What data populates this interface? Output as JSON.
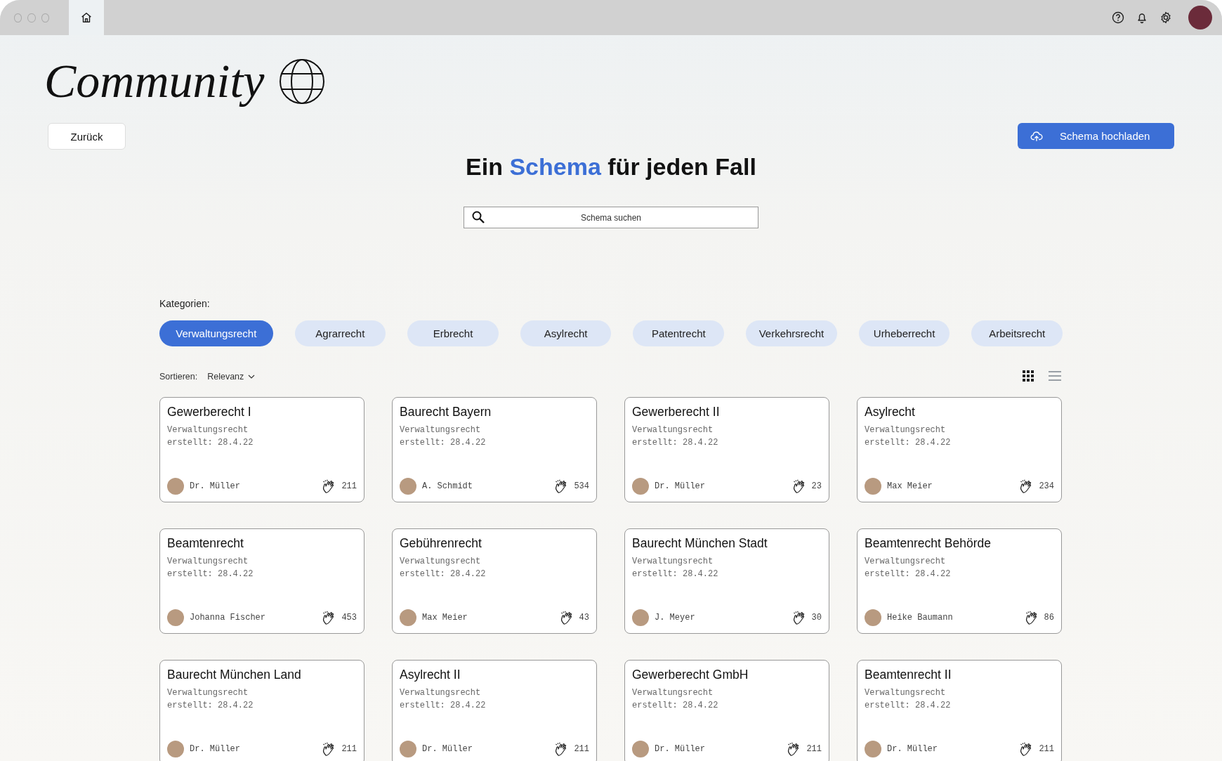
{
  "window": {
    "tabs": [
      {
        "kind": "home",
        "selected": true
      }
    ]
  },
  "page_title": "Community",
  "back_button": "Zurück",
  "upload_button": "Schema hochladen",
  "heading": [
    {
      "text": "Ein ",
      "accent": false
    },
    {
      "text": "Schema",
      "accent": true
    },
    {
      "text": " für jeden Fall",
      "accent": false
    }
  ],
  "search": {
    "placeholder": "Schema suchen"
  },
  "categories_label": "Kategorien:",
  "categories": [
    {
      "label": "Verwaltungsrecht",
      "selected": true
    },
    {
      "label": "Agrarrecht",
      "selected": false
    },
    {
      "label": "Erbrecht",
      "selected": false
    },
    {
      "label": "Asylrecht",
      "selected": false
    },
    {
      "label": "Patentrecht",
      "selected": false
    },
    {
      "label": "Verkehrsrecht",
      "selected": false
    },
    {
      "label": "Urheberrecht",
      "selected": false
    },
    {
      "label": "Arbeitsrecht",
      "selected": false
    }
  ],
  "sort": {
    "label": "Sortieren:",
    "value": "Relevanz"
  },
  "views": [
    {
      "kind": "grid",
      "selected": true
    },
    {
      "kind": "list",
      "selected": false
    }
  ],
  "cards": [
    {
      "title": "Gewerberecht I",
      "category": "Verwaltungsrecht",
      "created": "erstellt: 28.4.22",
      "author": "Dr. Müller",
      "claps": "211"
    },
    {
      "title": "Baurecht Bayern",
      "category": "Verwaltungsrecht",
      "created": "erstellt: 28.4.22",
      "author": "A. Schmidt",
      "claps": "534"
    },
    {
      "title": "Gewerberecht II",
      "category": "Verwaltungsrecht",
      "created": "erstellt: 28.4.22",
      "author": "Dr. Müller",
      "claps": "23"
    },
    {
      "title": "Asylrecht",
      "category": "Verwaltungsrecht",
      "created": "erstellt: 28.4.22",
      "author": "Max Meier",
      "claps": "234"
    },
    {
      "title": "Beamtenrecht",
      "category": "Verwaltungsrecht",
      "created": "erstellt: 28.4.22",
      "author": "Johanna Fischer",
      "claps": "453"
    },
    {
      "title": "Gebührenrecht",
      "category": "Verwaltungsrecht",
      "created": "erstellt: 28.4.22",
      "author": "Max Meier",
      "claps": "43"
    },
    {
      "title": "Baurecht München Stadt",
      "category": "Verwaltungsrecht",
      "created": "erstellt: 28.4.22",
      "author": "J. Meyer",
      "claps": "30"
    },
    {
      "title": "Beamtenrecht Behörde",
      "category": "Verwaltungsrecht",
      "created": "erstellt: 28.4.22",
      "author": "Heike Baumann",
      "claps": "86"
    },
    {
      "title": "Baurecht München Land",
      "category": "Verwaltungsrecht",
      "created": "erstellt: 28.4.22",
      "author": "Dr. Müller",
      "claps": "211"
    },
    {
      "title": "Asylrecht II",
      "category": "Verwaltungsrecht",
      "created": "erstellt: 28.4.22",
      "author": "Dr. Müller",
      "claps": "211"
    },
    {
      "title": "Gewerberecht GmbH",
      "category": "Verwaltungsrecht",
      "created": "erstellt: 28.4.22",
      "author": "Dr. Müller",
      "claps": "211"
    },
    {
      "title": "Beamtenrecht II",
      "category": "Verwaltungsrecht",
      "created": "erstellt: 28.4.22",
      "author": "Dr. Müller",
      "claps": "211"
    }
  ]
}
